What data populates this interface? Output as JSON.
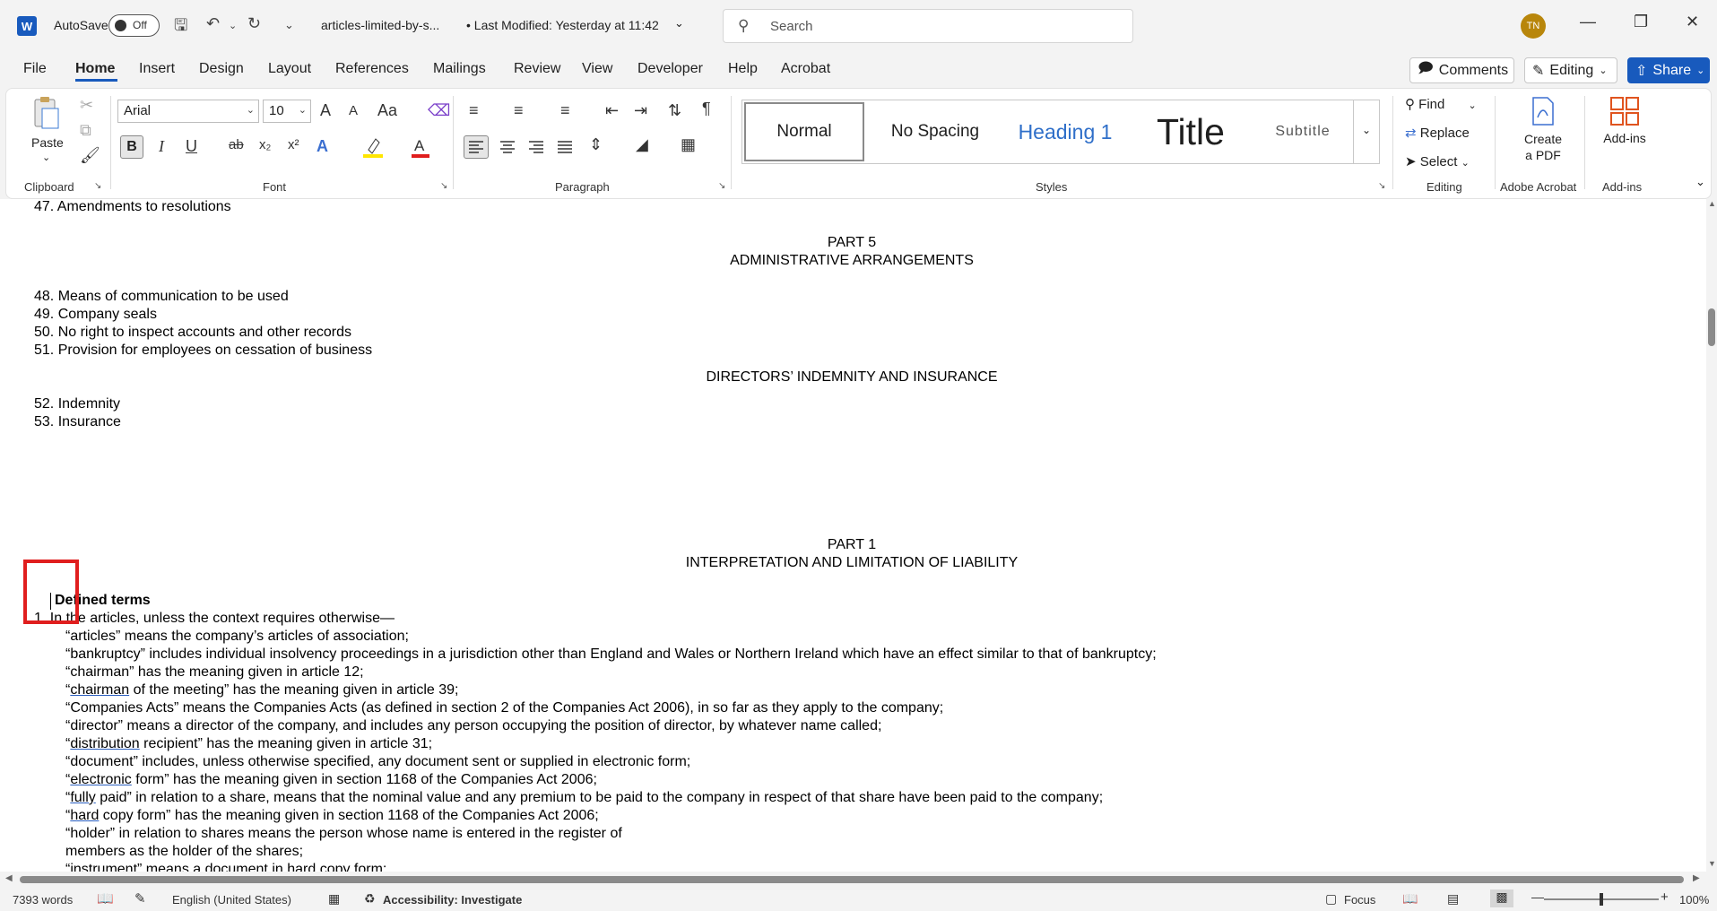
{
  "titlebar": {
    "app_icon": "W",
    "autosave_label": "AutoSave",
    "autosave_state": "Off",
    "document_name": "articles-limited-by-s...",
    "last_modified": "• Last Modified: Yesterday at 11:42",
    "search_placeholder": "Search",
    "user_initials": "TN"
  },
  "menu": {
    "tabs": [
      "File",
      "Home",
      "Insert",
      "Design",
      "Layout",
      "References",
      "Mailings",
      "Review",
      "View",
      "Developer",
      "Help",
      "Acrobat"
    ],
    "active_tab": "Home",
    "comments_label": "Comments",
    "editing_label": "Editing",
    "share_label": "Share"
  },
  "ribbon": {
    "clipboard": {
      "paste_label": "Paste",
      "group_label": "Clipboard"
    },
    "font": {
      "font_name": "Arial",
      "font_size": "10",
      "group_label": "Font",
      "bold": "B",
      "italic": "I",
      "underline": "U",
      "strike": "ab",
      "sub": "x₂",
      "sup": "x²",
      "change_case": "Aa",
      "grow": "A",
      "shrink": "A"
    },
    "paragraph": {
      "group_label": "Paragraph",
      "pilcrow": "¶"
    },
    "styles": {
      "group_label": "Styles",
      "items": [
        "Normal",
        "No Spacing",
        "Heading 1",
        "Title",
        "Subtitle"
      ]
    },
    "editing": {
      "find": "Find",
      "replace": "Replace",
      "select": "Select",
      "group_label": "Editing"
    },
    "acrobat": {
      "create_pdf": "Create",
      "create_pdf_2": "a PDF",
      "group_label": "Adobe Acrobat"
    },
    "addins": {
      "label": "Add-ins",
      "group_label": "Add-ins"
    }
  },
  "document": {
    "toc_top": "47. Amendments to resolutions",
    "part5_title": "PART 5",
    "part5_subtitle": "ADMINISTRATIVE ARRANGEMENTS",
    "part5_items": [
      "48. Means of communication to be used",
      "49. Company seals",
      "50. No right to inspect accounts and other records",
      "51. Provision for employees on cessation of business"
    ],
    "directors_heading": "DIRECTORS’ INDEMNITY AND INSURANCE",
    "directors_items": [
      "52. Indemnity",
      "53. Insurance"
    ],
    "part1_title": "PART 1",
    "part1_subtitle": "INTERPRETATION AND LIMITATION OF LIABILITY",
    "defined_terms_heading": "Defined terms",
    "article1_intro": "1. In the articles, unless the context requires otherwise—",
    "definitions": [
      {
        "pre": "“articles” means the company’s articles of association;",
        "u": "",
        "post": ""
      },
      {
        "pre": "“bankruptcy” includes individual insolvency proceedings in a jurisdiction other than England and Wales or Northern Ireland which have an effect similar to that of bankruptcy;",
        "u": "",
        "post": ""
      },
      {
        "pre": "“chairman” has the meaning given in article 12;",
        "u": "",
        "post": ""
      },
      {
        "pre": "“",
        "u": "chairman",
        "post": " of the meeting” has the meaning given in article 39;"
      },
      {
        "pre": "“Companies Acts” means the Companies Acts (as defined in section 2 of the Companies Act 2006), in so far as they apply to the company;",
        "u": "",
        "post": ""
      },
      {
        "pre": "“director” means a director of the company, and includes any person occupying the position of director, by whatever name called;",
        "u": "",
        "post": ""
      },
      {
        "pre": "“",
        "u": "distribution",
        "post": " recipient” has the meaning given in article 31;"
      },
      {
        "pre": "“document” includes, unless otherwise specified, any document sent or supplied in electronic form;",
        "u": "",
        "post": ""
      },
      {
        "pre": "“",
        "u": "electronic",
        "post": " form” has the meaning given in section 1168 of the Companies Act 2006;"
      },
      {
        "pre": "“",
        "u": "fully",
        "post": " paid” in relation to a share, means that the nominal value and any premium to be paid to the company in respect of that share have been paid to the company;"
      },
      {
        "pre": "“",
        "u": "hard",
        "post": " copy form” has the meaning given in section 1168 of the Companies Act 2006;"
      },
      {
        "pre": "“holder” in relation to shares means the person whose name is entered in the register of",
        "u": "",
        "post": ""
      },
      {
        "pre": "members as the holder of the shares;",
        "u": "",
        "post": ""
      },
      {
        "pre": "“instrument” means a document in hard copy form;",
        "u": "",
        "post": ""
      }
    ]
  },
  "statusbar": {
    "word_count": "7393 words",
    "language": "English (United States)",
    "accessibility": "Accessibility: Investigate",
    "focus": "Focus",
    "zoom": "100%",
    "zoom_level_fraction": 0.5
  },
  "colors": {
    "accent": "#185abd",
    "highlight_box": "#e01e1e"
  }
}
